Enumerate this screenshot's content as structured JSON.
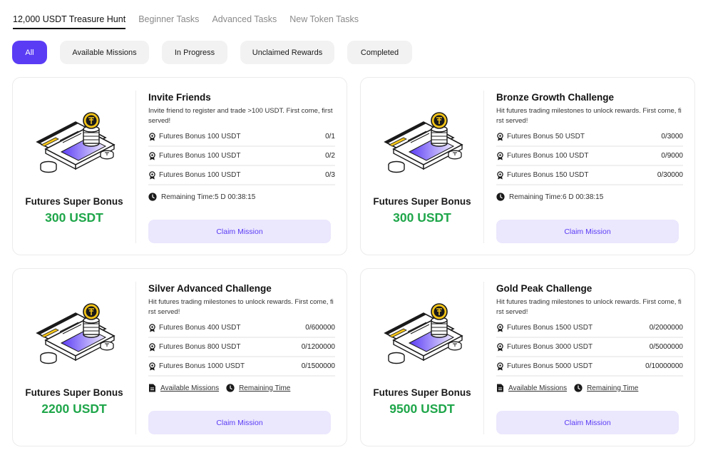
{
  "top_tabs": [
    {
      "label": "12,000 USDT Treasure Hunt",
      "active": true
    },
    {
      "label": "Beginner Tasks",
      "active": false
    },
    {
      "label": "Advanced Tasks",
      "active": false
    },
    {
      "label": "New Token Tasks",
      "active": false
    }
  ],
  "filters": [
    {
      "label": "All",
      "active": true
    },
    {
      "label": "Available Missions",
      "active": false
    },
    {
      "label": "In Progress",
      "active": false
    },
    {
      "label": "Unclaimed Rewards",
      "active": false
    },
    {
      "label": "Completed",
      "active": false
    }
  ],
  "colors": {
    "accent": "#5b3cf5",
    "accent_soft": "#ebe7fd",
    "reward_green": "#1fa64a",
    "coin_yellow": "#f5c518"
  },
  "cards": [
    {
      "bonus_label": "Futures Super Bonus",
      "bonus_amount": "300 USDT",
      "title": "Invite Friends",
      "description": "Invite friend to register and trade >100 USDT. First come, first served!",
      "tasks": [
        {
          "name": "Futures Bonus 100 USDT",
          "progress": "0/1"
        },
        {
          "name": "Futures Bonus 100 USDT",
          "progress": "0/2"
        },
        {
          "name": "Futures Bonus 100 USDT",
          "progress": "0/3"
        }
      ],
      "meta_type": "remaining",
      "remaining_time": "Remaining Time:5 D 00:38:15",
      "claim_label": "Claim Mission"
    },
    {
      "bonus_label": "Futures Super Bonus",
      "bonus_amount": "300 USDT",
      "title": "Bronze Growth Challenge",
      "description": "Hit futures trading milestones to unlock rewards. First come, first served!",
      "tasks": [
        {
          "name": "Futures Bonus 50 USDT",
          "progress": "0/3000"
        },
        {
          "name": "Futures Bonus 100 USDT",
          "progress": "0/9000"
        },
        {
          "name": "Futures Bonus 150 USDT",
          "progress": "0/30000"
        }
      ],
      "meta_type": "remaining",
      "remaining_time": "Remaining Time:6 D 00:38:15",
      "claim_label": "Claim Mission"
    },
    {
      "bonus_label": "Futures Super Bonus",
      "bonus_amount": "2200 USDT",
      "title": "Silver Advanced Challenge",
      "description": "Hit futures trading milestones to unlock rewards. First come, first served!",
      "tasks": [
        {
          "name": "Futures Bonus 400 USDT",
          "progress": "0/600000"
        },
        {
          "name": "Futures Bonus 800 USDT",
          "progress": "0/1200000"
        },
        {
          "name": "Futures Bonus 1000 USDT",
          "progress": "0/1500000"
        }
      ],
      "meta_type": "links",
      "link_missions": "Available Missions",
      "link_time": "Remaining Time",
      "claim_label": "Claim Mission"
    },
    {
      "bonus_label": "Futures Super Bonus",
      "bonus_amount": "9500 USDT",
      "title": "Gold Peak Challenge",
      "description": "Hit futures trading milestones to unlock rewards. First come, first served!",
      "tasks": [
        {
          "name": "Futures Bonus 1500 USDT",
          "progress": "0/2000000"
        },
        {
          "name": "Futures Bonus 3000 USDT",
          "progress": "0/5000000"
        },
        {
          "name": "Futures Bonus 5000 USDT",
          "progress": "0/10000000"
        }
      ],
      "meta_type": "links",
      "link_missions": "Available Missions",
      "link_time": "Remaining Time",
      "claim_label": "Claim Mission"
    }
  ]
}
